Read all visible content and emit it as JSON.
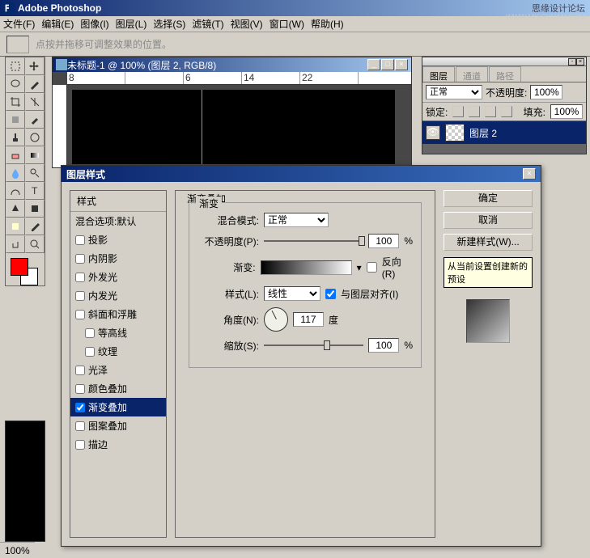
{
  "app_title": "Adobe Photoshop",
  "watermark": "思缘设计论坛",
  "watermark2": "WWW.MISSYUAN.COM",
  "menus": [
    "文件(F)",
    "编辑(E)",
    "图像(I)",
    "图层(L)",
    "选择(S)",
    "滤镜(T)",
    "视图(V)",
    "窗口(W)",
    "帮助(H)"
  ],
  "optbar_hint": "点按并拖移可调整效果的位置。",
  "doc_title": "未标题-1 @ 100% (图层 2, RGB/8)",
  "ruler_marks": [
    "8",
    "",
    "6",
    "14",
    "22"
  ],
  "zoom": "100%",
  "layers_panel": {
    "tabs": [
      "图层",
      "通道",
      "路径"
    ],
    "blend": "正常",
    "opacity_label": "不透明度:",
    "opacity": "100%",
    "lock_label": "锁定:",
    "fill_label": "填充:",
    "fill": "100%",
    "layer_name": "图层 2"
  },
  "dialog": {
    "title": "图层样式",
    "styles_header": "样式",
    "blend_opts": "混合选项:默认",
    "effects": [
      "投影",
      "内阴影",
      "外发光",
      "内发光",
      "斜面和浮雕",
      "等高线",
      "纹理",
      "光泽",
      "颜色叠加",
      "渐变叠加",
      "图案叠加",
      "描边"
    ],
    "indent_idx": [
      5,
      6
    ],
    "selected_idx": 9,
    "section_label": "渐变叠加",
    "subsection_label": "渐变",
    "blend_mode_label": "混合模式:",
    "blend_mode": "正常",
    "opacity_label": "不透明度(P):",
    "opacity": "100",
    "pct": "%",
    "gradient_label": "渐变:",
    "reverse_label": "反向(R)",
    "style_label": "样式(L):",
    "style": "线性",
    "align_label": "与图层对齐(I)",
    "angle_label": "角度(N):",
    "angle": "117",
    "angle_unit": "度",
    "scale_label": "缩放(S):",
    "scale": "100",
    "btn_ok": "确定",
    "btn_cancel": "取消",
    "btn_newstyle": "新建样式(W)...",
    "tooltip": "从当前设置创建新的预设"
  }
}
